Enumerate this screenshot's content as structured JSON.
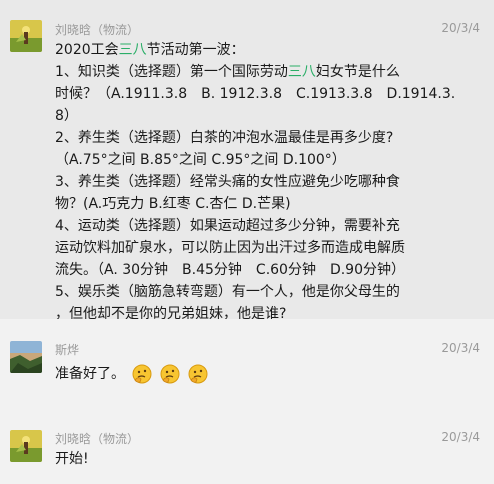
{
  "messages": [
    {
      "sender": "刘晓晗（物流）",
      "time": "20/3/4",
      "lines": [
        [
          "2020工会",
          "三八",
          "节活动第一波："
        ],
        [
          "1、知识类（选择题）第一个国际劳动",
          "三八",
          "妇女节是什么"
        ],
        [
          "时候？（A.1911.3.8　B. 1912.3.8　C.1913.3.8　D.1914.3.",
          "",
          ""
        ],
        [
          "8）",
          "",
          ""
        ],
        [
          "2、养生类（选择题）白茶的冲泡水温最佳是再多少度?",
          "",
          ""
        ],
        [
          "（A.75°之间  B.85°之间 C.95°之间  D.100°）",
          "",
          ""
        ],
        [
          "3、养生类（选择题）经常头痛的女性应避免少吃哪种食",
          "",
          ""
        ],
        [
          "物？(A.巧克力 B.红枣 C.杏仁 D.芒果)",
          "",
          ""
        ],
        [
          "4、运动类（选择题）如果运动超过多少分钟，需要补充",
          "",
          ""
        ],
        [
          "运动饮料加矿泉水，可以防止因为出汗过多而造成电解质",
          "",
          ""
        ],
        [
          "流失。（A. 30分钟　B.45分钟　C.60分钟　D.90分钟）",
          "",
          ""
        ],
        [
          "5、娱乐类（脑筋急转弯题）有一个人，他是你父母生的",
          "",
          ""
        ],
        [
          "，但他却不是你的兄弟姐妹，他是谁? ________",
          "",
          ""
        ]
      ]
    },
    {
      "sender": "斯烨",
      "time": "20/3/4",
      "text": "准备好了。",
      "emojis": [
        "thinking-face-icon",
        "thinking-face-icon",
        "thinking-face-icon"
      ]
    },
    {
      "sender": "刘晓晗（物流）",
      "time": "20/3/4",
      "text": "开始!"
    }
  ],
  "colors": {
    "highlight": "#2aae67",
    "meta_text": "#9a9a9a",
    "selected_row_bg": "#e9e9e9",
    "panel_bg": "#f2f2f2"
  }
}
